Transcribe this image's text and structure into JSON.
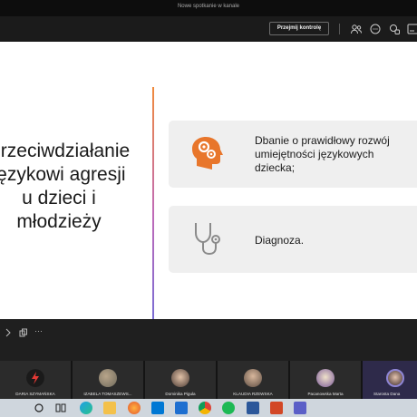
{
  "window": {
    "title": "Nowe spotkanie w kanale"
  },
  "toolbar": {
    "take_control_label": "Przejmij kontrolę"
  },
  "slide": {
    "title_lines": [
      "Przeciwdziałanie",
      "językowi agresji",
      "u dzieci i",
      "młodzieży"
    ],
    "cards": [
      {
        "lines": [
          "Dbanie o prawidłowy rozwój",
          "umiejętności językowych",
          "dziecka;"
        ],
        "icon": "head-gears-icon"
      },
      {
        "lines": [
          "Diagnoza."
        ],
        "icon": "stethoscope-icon"
      }
    ]
  },
  "controls": {
    "more_label": "···"
  },
  "participants": [
    {
      "name": "DARIA SZYMAŃSKA",
      "avatar": "lightning-avatar"
    },
    {
      "name": "IZABELA TOMASZEWS...",
      "avatar": "photo-avatar"
    },
    {
      "name": "Dominika Pigula",
      "avatar": "photo-avatar"
    },
    {
      "name": "KLAUDIA RZEWSKA",
      "avatar": "photo-avatar"
    },
    {
      "name": "Pacanowska Marta",
      "avatar": "photo-avatar"
    },
    {
      "name": "Starosta Dana",
      "avatar": "photo-avatar"
    }
  ],
  "colors": {
    "accent_orange": "#e8762b",
    "card_bg": "#efefef"
  }
}
